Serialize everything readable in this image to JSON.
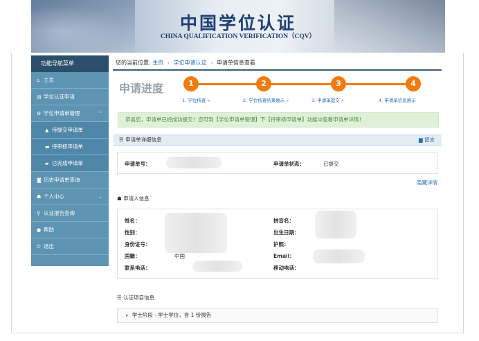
{
  "banner": {
    "title_cn": "中国学位认证",
    "title_en": "CHINA QUALIFICATION VERIFICATION（CQV）"
  },
  "sidebar": {
    "header": "功能导航菜单",
    "items": [
      {
        "label": "主页",
        "icon": "home-icon",
        "glyph": "⌂"
      },
      {
        "label": "学位认证申请",
        "icon": "document-icon",
        "glyph": "▤"
      },
      {
        "label": "学位申请单管理",
        "icon": "gear-icon",
        "glyph": "⚙",
        "expanded": true
      },
      {
        "label": "待提交申请单",
        "icon": "warning-icon",
        "glyph": "▲",
        "sub": true
      },
      {
        "label": "待审核申请单",
        "icon": "cart-icon",
        "glyph": "▬",
        "sub": true
      },
      {
        "label": "已完成申请单",
        "icon": "folder-icon",
        "glyph": "▰",
        "sub": true
      },
      {
        "label": "历史申请单查询",
        "icon": "camera-icon",
        "glyph": "◙"
      },
      {
        "label": "个人中心",
        "icon": "user-icon",
        "glyph": "☗",
        "collapsible": true
      },
      {
        "label": "认证报告查询",
        "icon": "search-icon",
        "glyph": "⚲"
      },
      {
        "label": "帮助",
        "icon": "help-icon",
        "glyph": "●"
      },
      {
        "label": "退出",
        "icon": "power-icon",
        "glyph": "⏻"
      }
    ]
  },
  "breadcrumb": {
    "prefix": "您的当前位置:",
    "home": "主页",
    "level1": "学位申请认证",
    "current": "申请单信息查看"
  },
  "progress": {
    "title": "申请进度",
    "color": "#f07b0e",
    "steps": [
      {
        "num": "1",
        "label": "1. 学位核查   »"
      },
      {
        "num": "2",
        "label": "2. 学位核查结果展示   »"
      },
      {
        "num": "3",
        "label": "3. 申请单提交   »"
      },
      {
        "num": "4",
        "label": "4. 申请单信息展示"
      }
    ]
  },
  "alert": {
    "text": "恭喜您，申请单已经成功提交！您可到【学位申请单管理】下【待审核申请单】功能中查看申请单详情！"
  },
  "panel": {
    "title": "申请单详细信息",
    "message_link": "留言",
    "app_no_label": "申请单号：",
    "status_label": "申请单状态：",
    "status_value": "已提交",
    "hide_link": "隐藏详情"
  },
  "applicant": {
    "section_title": "申请人信息",
    "fields_left": [
      "姓名：",
      "性别：",
      "身份证号：",
      "国籍：",
      "联系电话："
    ],
    "nationality_value": "中国",
    "fields_right": [
      "拼音名：",
      "出生日期：",
      "护照：",
      "Email：",
      "移动电话："
    ]
  },
  "project": {
    "section_title": "认证项目信息",
    "degree_row": "学士阶段 - 学士学位，含 1 份报告"
  }
}
